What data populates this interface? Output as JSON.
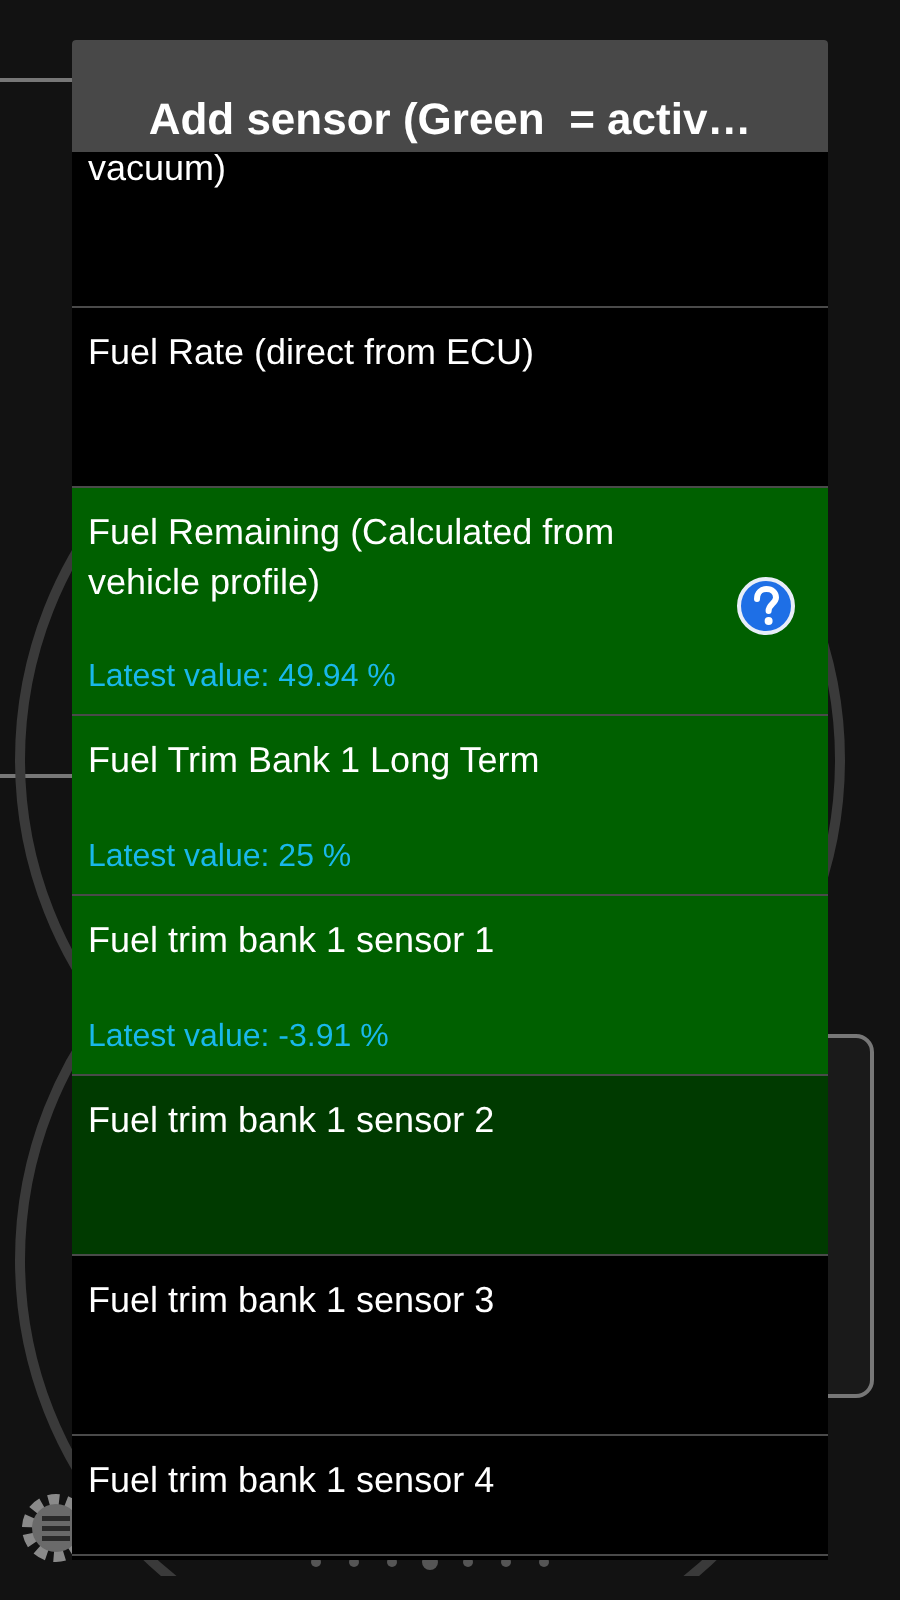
{
  "dialog": {
    "title": "Add sensor (Green  = activ…"
  },
  "sensors": [
    {
      "name": "vacuum)",
      "active": false,
      "selected": false
    },
    {
      "name": "Fuel Rate (direct from ECU)",
      "active": false,
      "selected": false
    },
    {
      "name": "Fuel Remaining (Calculated from vehicle profile)",
      "active": true,
      "selected": false,
      "help": true,
      "latest": "Latest value: 49.94 %"
    },
    {
      "name": "Fuel Trim Bank 1 Long Term",
      "active": true,
      "selected": false,
      "latest": "Latest value: 25 %"
    },
    {
      "name": "Fuel trim bank 1 sensor 1",
      "active": true,
      "selected": false,
      "latest": "Latest value: -3.91 %"
    },
    {
      "name": "Fuel trim bank 1 sensor 2",
      "active": false,
      "selected": true
    },
    {
      "name": "Fuel trim bank 1 sensor 3",
      "active": false,
      "selected": false
    },
    {
      "name": "Fuel trim bank 1 sensor 4",
      "active": false,
      "selected": false
    }
  ]
}
